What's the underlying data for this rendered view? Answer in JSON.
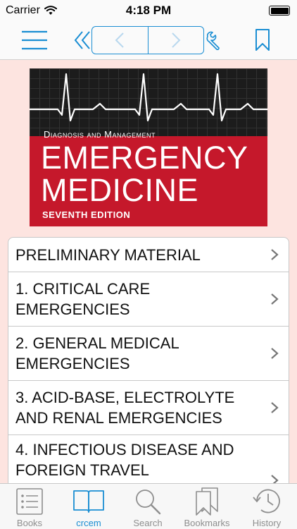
{
  "status_bar": {
    "carrier": "Carrier",
    "time": "4:18 PM",
    "battery_level": 1.0
  },
  "nav_bar": {
    "icons": [
      "menu-icon",
      "double-chevron-left-icon",
      "chevron-left-icon",
      "chevron-right-icon",
      "wrench-icon",
      "bookmark-icon"
    ],
    "accent_color": "#1a8ed3"
  },
  "cover": {
    "subtitle": "Diagnosis and Management",
    "title_line1": "EMERGENCY",
    "title_line2": "MEDICINE",
    "edition": "SEVENTH EDITION",
    "colors": {
      "red": "#c5182b",
      "dark": "#1c1c1c"
    }
  },
  "toc": {
    "items": [
      {
        "label": "PRELIMINARY MATERIAL"
      },
      {
        "label": "1. CRITICAL CARE EMERGENCIES"
      },
      {
        "label": "2. GENERAL MEDICAL EMERGENCIES"
      },
      {
        "label": "3. ACID-BASE, ELECTROLYTE AND RENAL EMERGENCIES"
      },
      {
        "label": "4. INFECTIOUS DISEASE AND FOREIGN TRAVEL"
      }
    ]
  },
  "tab_bar": {
    "tabs": [
      {
        "label": "Books",
        "icon": "list-icon"
      },
      {
        "label": "crcem",
        "icon": "open-book-icon",
        "active": true
      },
      {
        "label": "Search",
        "icon": "search-icon"
      },
      {
        "label": "Bookmarks",
        "icon": "bookmarks-icon"
      },
      {
        "label": "History",
        "icon": "clock-icon"
      }
    ]
  },
  "colors": {
    "background": "#fde4e0",
    "accent": "#1a8ed3",
    "inactive": "#8e8e8e"
  }
}
